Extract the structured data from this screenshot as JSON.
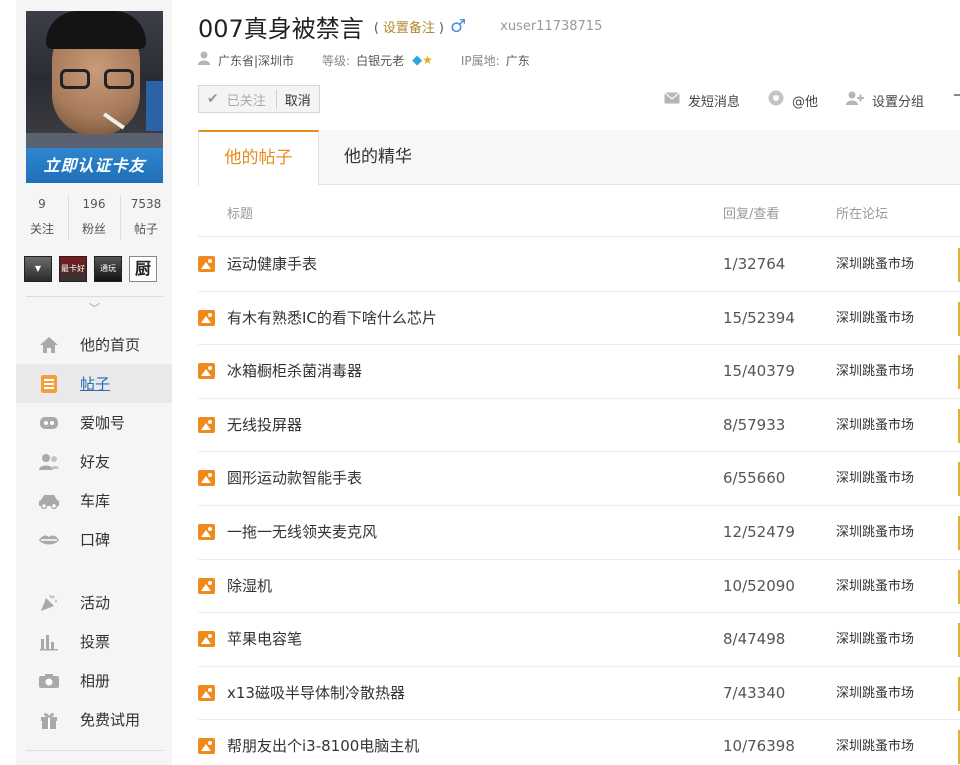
{
  "profile": {
    "verify_badge": "立即认证卡友",
    "username": "007真身被禁言",
    "remark_open": "(",
    "remark_link": "设置备注",
    "remark_close": ")",
    "gender_symbol": "♂",
    "uid": "xuser11738715",
    "location": "广东省|深圳市",
    "level_key": "等级:",
    "level_value": "白银元老",
    "ip_key": "IP属地:",
    "ip_value": "广东"
  },
  "stats": [
    {
      "num": "9",
      "label": "关注"
    },
    {
      "num": "196",
      "label": "粉丝"
    },
    {
      "num": "7538",
      "label": "帖子"
    }
  ],
  "medals": [
    {
      "text": "▼"
    },
    {
      "text": "最卡好司机"
    },
    {
      "text": "通玩"
    },
    {
      "text": "厨"
    }
  ],
  "follow": {
    "followed_label": "已关注",
    "cancel_label": "取消"
  },
  "actions": [
    {
      "icon": "envelope-icon",
      "label": "发短消息"
    },
    {
      "icon": "at-icon",
      "label": "@他"
    },
    {
      "icon": "user-group-icon",
      "label": "设置分组"
    }
  ],
  "nav": [
    {
      "icon": "home-icon",
      "label": "他的首页"
    },
    {
      "icon": "post-icon",
      "label": "帖子",
      "active": true
    },
    {
      "icon": "aika-icon",
      "label": "爱咖号"
    },
    {
      "icon": "friends-icon",
      "label": "好友"
    },
    {
      "icon": "car-icon",
      "label": "车库"
    },
    {
      "icon": "lips-icon",
      "label": "口碑"
    },
    {
      "icon": "party-icon",
      "label": "活动"
    },
    {
      "icon": "chart-icon",
      "label": "投票"
    },
    {
      "icon": "camera-icon",
      "label": "相册"
    },
    {
      "icon": "gift-icon",
      "label": "免费试用"
    }
  ],
  "tabs": [
    {
      "label": "他的帖子"
    },
    {
      "label": "他的精华"
    }
  ],
  "table": {
    "headers": {
      "title": "标题",
      "reply": "回复/查看",
      "forum": "所在论坛"
    },
    "rows": [
      {
        "title": "运动健康手表",
        "reply": "1/32764",
        "forum": "深圳跳蚤市场"
      },
      {
        "title": "有木有熟悉IC的看下啥什么芯片",
        "reply": "15/52394",
        "forum": "深圳跳蚤市场"
      },
      {
        "title": "冰箱橱柜杀菌消毒器",
        "reply": "15/40379",
        "forum": "深圳跳蚤市场"
      },
      {
        "title": "无线投屏器",
        "reply": "8/57933",
        "forum": "深圳跳蚤市场"
      },
      {
        "title": "圆形运动款智能手表",
        "reply": "6/55660",
        "forum": "深圳跳蚤市场"
      },
      {
        "title": "一拖一无线领夹麦克风",
        "reply": "12/52479",
        "forum": "深圳跳蚤市场"
      },
      {
        "title": "除湿机",
        "reply": "10/52090",
        "forum": "深圳跳蚤市场"
      },
      {
        "title": "苹果电容笔",
        "reply": "8/47498",
        "forum": "深圳跳蚤市场"
      },
      {
        "title": "x13磁吸半导体制冷散热器",
        "reply": "7/43340",
        "forum": "深圳跳蚤市场"
      },
      {
        "title": "帮朋友出个i3-8100电脑主机",
        "reply": "10/76398",
        "forum": "深圳跳蚤市场"
      }
    ]
  },
  "colors": {
    "accent_orange": "#e88a1d",
    "link_blue": "#2a6ab5",
    "verify_blue": "#1f6fb7"
  }
}
